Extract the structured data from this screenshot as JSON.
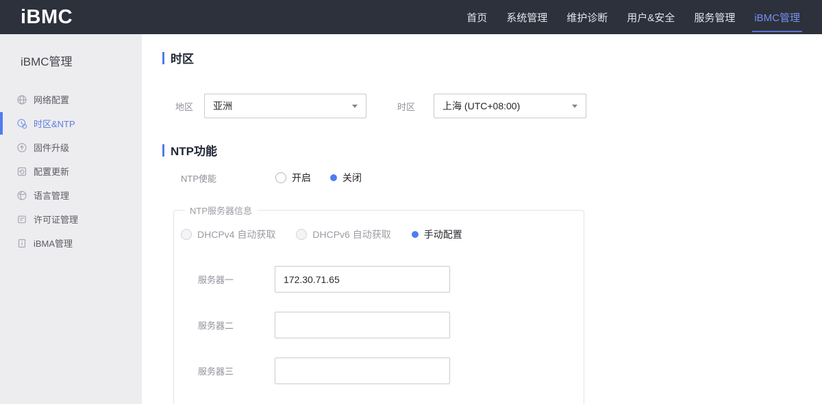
{
  "colors": {
    "accent": "#4e7cf0",
    "topbar_bg": "#2d313c",
    "sidebar_bg": "#ededef",
    "nav_active": "#7490ef",
    "disabled_text": "#9b9ca3"
  },
  "topbar": {
    "logo": "iBMC",
    "nav": [
      {
        "label": "首页",
        "active": false
      },
      {
        "label": "系统管理",
        "active": false
      },
      {
        "label": "维护诊断",
        "active": false
      },
      {
        "label": "用户&安全",
        "active": false
      },
      {
        "label": "服务管理",
        "active": false
      },
      {
        "label": "iBMC管理",
        "active": true
      }
    ]
  },
  "sidebar": {
    "title": "iBMC管理",
    "items": [
      {
        "label": "网络配置",
        "icon": "network-globe-icon",
        "active": false
      },
      {
        "label": "时区&NTP",
        "icon": "clock-sync-icon",
        "active": true
      },
      {
        "label": "固件升级",
        "icon": "upgrade-arrow-icon",
        "active": false
      },
      {
        "label": "配置更新",
        "icon": "config-update-icon",
        "active": false
      },
      {
        "label": "语言管理",
        "icon": "language-globe-icon",
        "active": false
      },
      {
        "label": "许可证管理",
        "icon": "license-document-icon",
        "active": false
      },
      {
        "label": "iBMA管理",
        "icon": "ibma-document-icon",
        "active": false
      }
    ],
    "collapse_icon": "chevron-left"
  },
  "timezone_section": {
    "title": "时区",
    "region_label": "地区",
    "region_value": "亚洲",
    "timezone_label": "时区",
    "timezone_value": "上海 (UTC+08:00)"
  },
  "ntp_section": {
    "title": "NTP功能",
    "enable_label": "NTP使能",
    "enable_options": [
      {
        "label": "开启",
        "selected": false
      },
      {
        "label": "关闭",
        "selected": true
      }
    ],
    "server_group": {
      "legend": "NTP服务器信息",
      "mode_options": [
        {
          "label": "DHCPv4 自动获取",
          "selected": false,
          "disabled": true
        },
        {
          "label": "DHCPv6 自动获取",
          "selected": false,
          "disabled": true
        },
        {
          "label": "手动配置",
          "selected": true,
          "disabled": false
        }
      ],
      "servers": [
        {
          "label": "服务器一",
          "value": "172.30.71.65"
        },
        {
          "label": "服务器二",
          "value": ""
        },
        {
          "label": "服务器三",
          "value": ""
        }
      ]
    }
  }
}
